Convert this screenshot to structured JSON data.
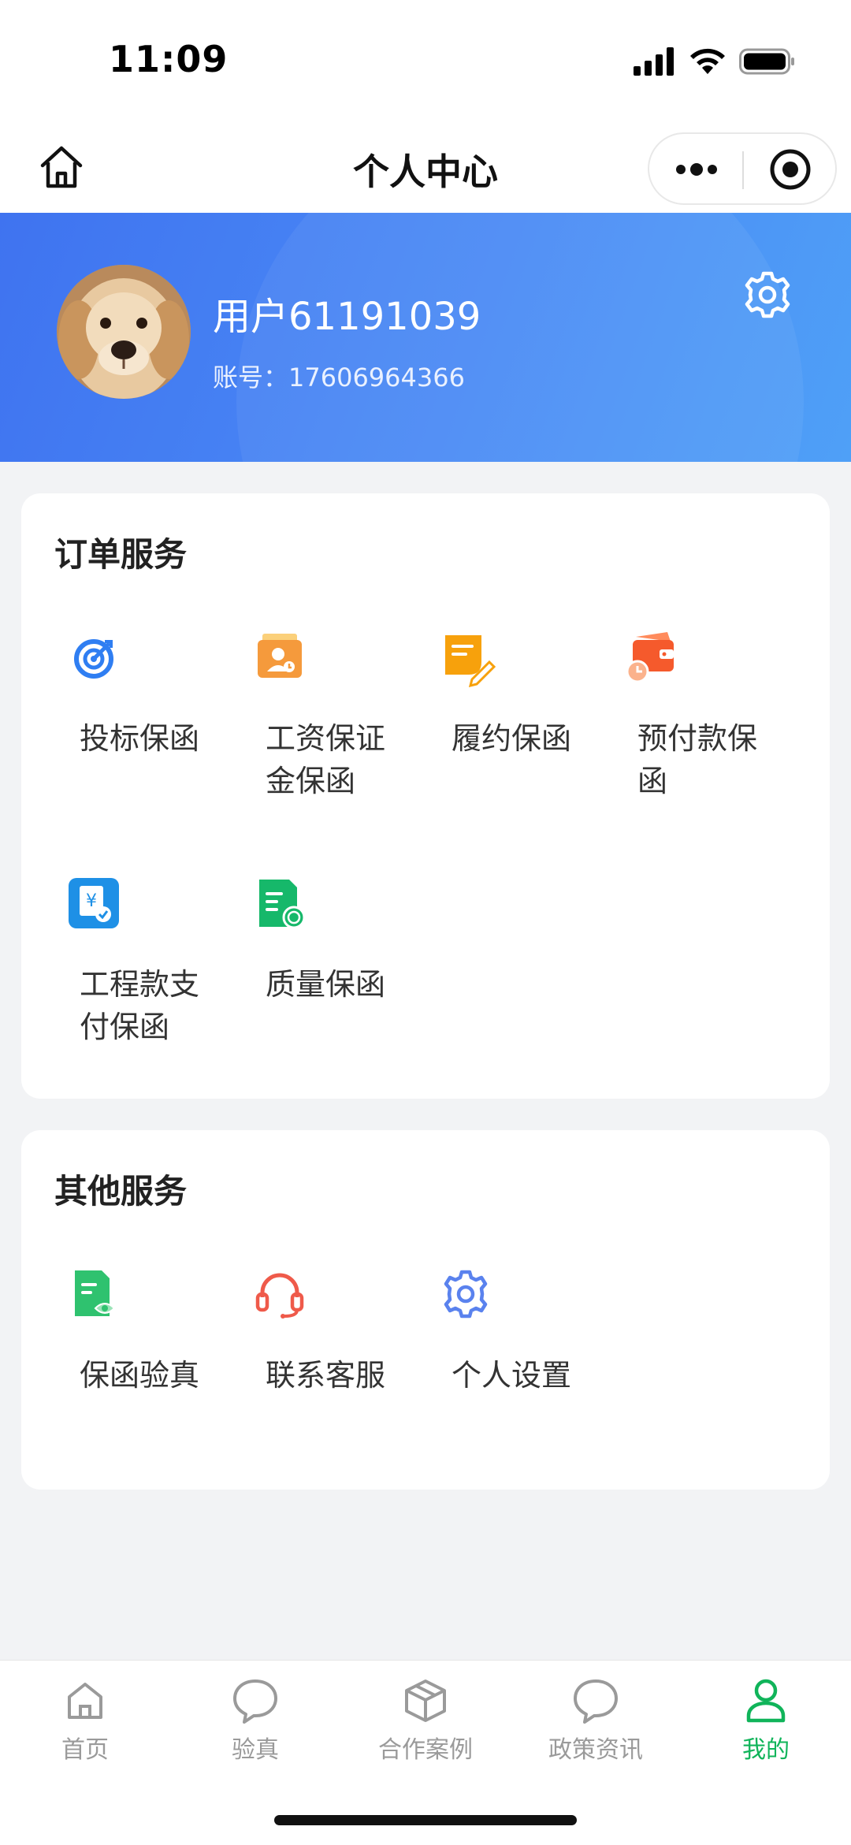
{
  "status_bar": {
    "time": "11:09"
  },
  "nav": {
    "title": "个人中心"
  },
  "profile": {
    "name": "用户61191039",
    "account": "账号：17606964366"
  },
  "order_services": {
    "title": "订单服务",
    "items": [
      {
        "label": "投标保函",
        "icon": "target-icon",
        "color": "#2f7ef2"
      },
      {
        "label": "工资保证金保函",
        "icon": "worker-badge-icon",
        "color": "#f59a3c"
      },
      {
        "label": "履约保函",
        "icon": "note-edit-icon",
        "color": "#f7a10c"
      },
      {
        "label": "预付款保函",
        "icon": "wallet-clock-icon",
        "color": "#f55a2c"
      },
      {
        "label": "工程款支付保函",
        "icon": "yuan-payment-icon",
        "color": "#1e90e6"
      },
      {
        "label": "质量保函",
        "icon": "quality-document-icon",
        "color": "#16b86a"
      }
    ]
  },
  "other_services": {
    "title": "其他服务",
    "items": [
      {
        "label": "保函验真",
        "icon": "verify-document-icon",
        "color": "#2fc26f"
      },
      {
        "label": "联系客服",
        "icon": "headset-icon",
        "color": "#ef5a4a"
      },
      {
        "label": "个人设置",
        "icon": "settings-gear-icon",
        "color": "#5a82ee"
      }
    ]
  },
  "tabbar": {
    "items": [
      {
        "label": "首页",
        "icon": "home-icon"
      },
      {
        "label": "验真",
        "icon": "chat-bubble-icon"
      },
      {
        "label": "合作案例",
        "icon": "box-icon"
      },
      {
        "label": "政策资讯",
        "icon": "chat-bubble-icon"
      },
      {
        "label": "我的",
        "icon": "person-icon",
        "active": true
      }
    ],
    "active_color": "#10b45a"
  }
}
